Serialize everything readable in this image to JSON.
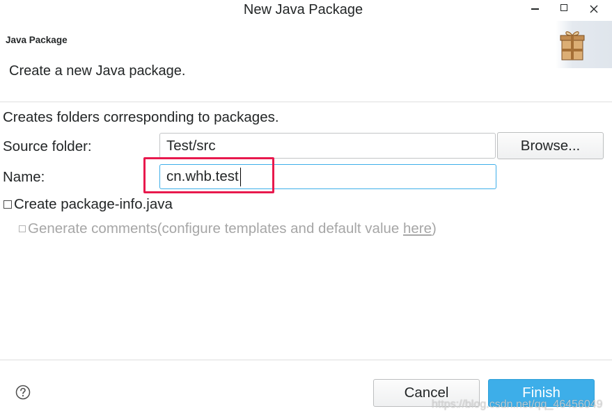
{
  "window": {
    "title": "New Java Package",
    "minimize_icon": "minimize-icon",
    "maximize_icon": "maximize-icon",
    "close_icon": "close-icon"
  },
  "header": {
    "title": "Java Package",
    "description": "Create a new Java package.",
    "icon": "package-icon"
  },
  "form": {
    "intro": "Creates folders corresponding to packages.",
    "source_folder": {
      "label": "Source folder:",
      "value": "Test/src",
      "browse_label": "Browse..."
    },
    "name": {
      "label": "Name:",
      "value": "cn.whb.test",
      "focused": true
    },
    "package_info": {
      "label": "Create package-info.java",
      "checked": false
    },
    "generate_comments": {
      "label_before_link": "Generate comments(configure templates and default value ",
      "link": "here",
      "label_after_link": ")",
      "checked": false,
      "enabled": false
    }
  },
  "footer": {
    "help_icon": "help-icon",
    "cancel_label": "Cancel",
    "finish_label": "Finish"
  },
  "watermark": "https://blog.csdn.net/qq_46456049",
  "colors": {
    "accent": "#3daee9",
    "text": "#232627",
    "disabled_text": "#a6a6a6",
    "separator": "#dedede",
    "highlight_box": "#e8194d"
  }
}
